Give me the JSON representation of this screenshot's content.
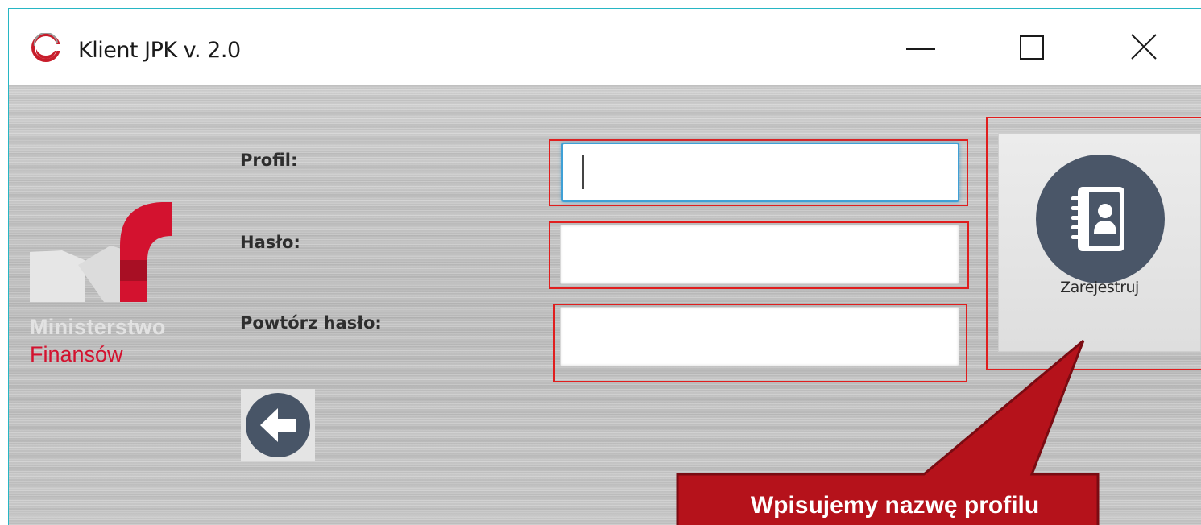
{
  "window": {
    "title": "Klient JPK v. 2.0",
    "controls": [
      "minimize-icon",
      "maximize-icon",
      "close-icon"
    ],
    "accent_color": "#27b6c4"
  },
  "logo": {
    "line1": "Ministerstwo",
    "line2": "Finansów",
    "brand_color": "#d3122f"
  },
  "form": {
    "profile_label": "Profil:",
    "profile_value": "",
    "password_label": "Hasło:",
    "password_value": "",
    "repeat_password_label": "Powtórz hasło:",
    "repeat_password_value": ""
  },
  "register_button": {
    "label": "Zarejestruj",
    "icon": "address-book-icon"
  },
  "back_button": {
    "icon": "arrow-left-icon"
  },
  "annotation": {
    "text": "Wpisujemy nazwę profilu",
    "color": "#b5121b",
    "highlight_color": "#e01e1e"
  }
}
